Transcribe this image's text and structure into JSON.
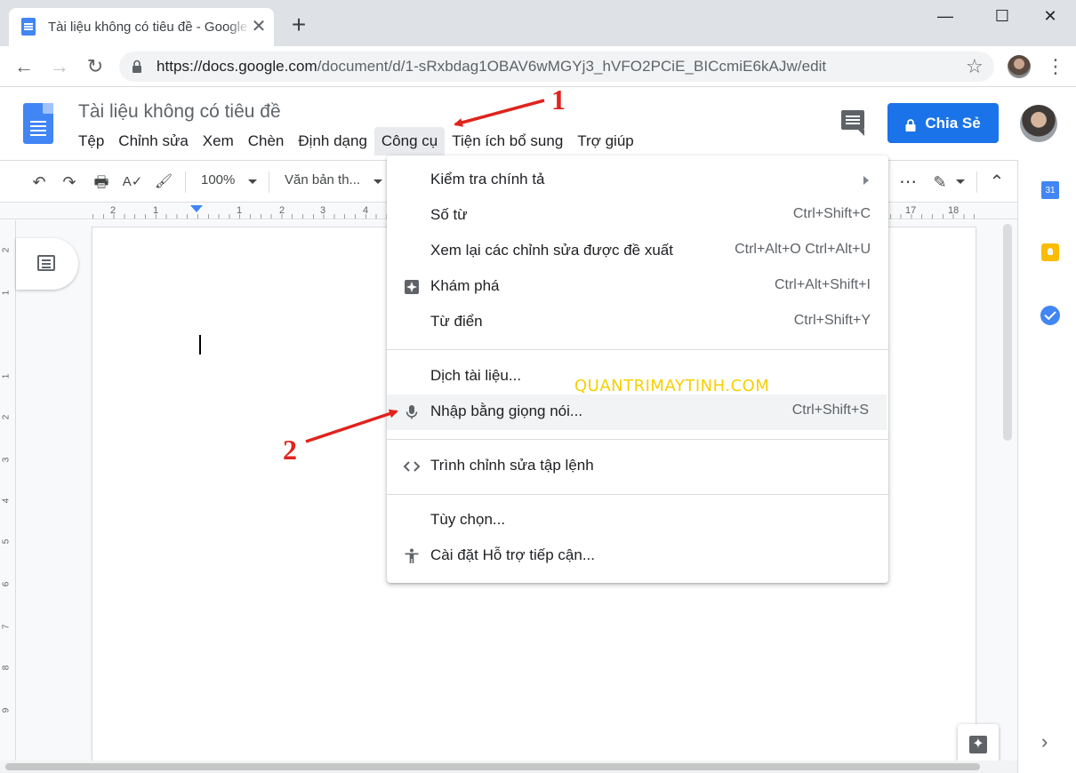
{
  "browser": {
    "tab_title": "Tài liệu không có tiêu đề - Google Tài liệu",
    "tab_close": "✕",
    "new_tab": "+",
    "window_controls": {
      "minimize": "—",
      "maximize": "☐",
      "close": "✕"
    },
    "nav": {
      "back": "←",
      "forward": "→",
      "reload": "↻"
    },
    "url_host": "https://docs.google.com",
    "url_path": "/document/d/1-sRxbdag1OBAV6wMGYj3_hVFO2PCiE_BICcmiE6kAJw/edit",
    "star": "☆",
    "menu": "⋮"
  },
  "docs": {
    "title": "Tài liệu không có tiêu đề",
    "menus": [
      "Tệp",
      "Chỉnh sửa",
      "Xem",
      "Chèn",
      "Định dạng",
      "Công cụ",
      "Tiện ích bổ sung",
      "Trợ giúp"
    ],
    "share_label": "Chia Sẻ"
  },
  "toolbar": {
    "undo": "↶",
    "redo": "↷",
    "print": "🖶",
    "spellcheck": "A✓",
    "paint_format": "🖌",
    "zoom": "100%",
    "style": "Văn bản th...",
    "more": "⋯",
    "edit_mode": "✎",
    "collapse": "⌃"
  },
  "ruler": {
    "labels": [
      "2",
      "1",
      "1",
      "2",
      "3",
      "4",
      "17",
      "18"
    ],
    "vertical_labels": [
      "2",
      "1",
      "1",
      "2",
      "3",
      "4",
      "5",
      "6",
      "7",
      "8",
      "9"
    ]
  },
  "tools_menu": {
    "items": [
      {
        "label": "Kiểm tra chính tả",
        "shortcut": "",
        "icon": "",
        "submenu": true
      },
      {
        "label": "Số từ",
        "shortcut": "Ctrl+Shift+C",
        "icon": ""
      },
      {
        "label": "Xem lại các chỉnh sửa được đề xuất",
        "shortcut": "Ctrl+Alt+O Ctrl+Alt+U",
        "icon": ""
      },
      {
        "label": "Khám phá",
        "shortcut": "Ctrl+Alt+Shift+I",
        "icon": "explore-icon"
      },
      {
        "label": "Từ điển",
        "shortcut": "Ctrl+Shift+Y",
        "icon": ""
      },
      {
        "label": "Dịch tài liệu...",
        "shortcut": "",
        "icon": ""
      },
      {
        "label": "Nhập bằng giọng nói...",
        "shortcut": "Ctrl+Shift+S",
        "icon": "microphone-icon"
      },
      {
        "label": "Trình chỉnh sửa tập lệnh",
        "shortcut": "",
        "icon": "code-icon"
      },
      {
        "label": "Tùy chọn...",
        "shortcut": "",
        "icon": ""
      },
      {
        "label": "Cài đặt Hỗ trợ tiếp cận...",
        "shortcut": "",
        "icon": "accessibility-icon"
      }
    ]
  },
  "side_panel": {
    "calendar_day": "31",
    "expand": "›"
  },
  "watermark": "QUANTRIMAYTINH.COM",
  "annotations": {
    "step1": "1",
    "step2": "2"
  },
  "colors": {
    "accent": "#1a73e8",
    "annotation": "#e0231c",
    "watermark": "#f5d000"
  }
}
